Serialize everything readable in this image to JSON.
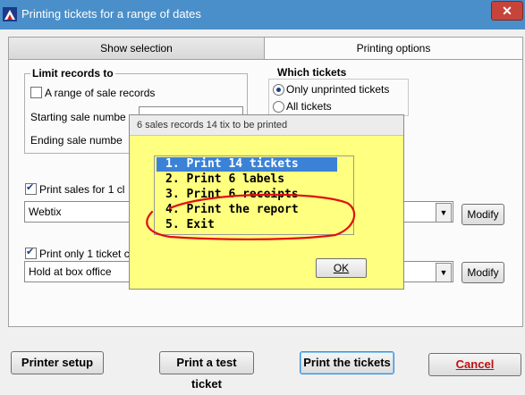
{
  "window": {
    "title": "Printing tickets for a range of dates",
    "close_glyph": "✕"
  },
  "tabs": [
    "Show selection",
    "Printing options"
  ],
  "limit": {
    "heading": "Limit records to",
    "range_check_label": "A range of sale records",
    "starting_label": "Starting sale numbe",
    "ending_label": "Ending sale numbe"
  },
  "which": {
    "heading": "Which tickets",
    "opt_unprinted": "Only unprinted tickets",
    "opt_all": "All tickets"
  },
  "print_sales": {
    "label": "Print sales for 1 cl",
    "combo_value": "Webtix",
    "modify_label": "Modify"
  },
  "print_only": {
    "label": "Print only 1 ticket c",
    "combo_value": "Hold at box office",
    "modify_label": "Modify"
  },
  "dialog": {
    "header": "6 sales records  14 tix to be printed",
    "items": [
      "1. Print 14 tickets",
      "2. Print 6 labels",
      "3. Print 6 receipts",
      "4. Print the report",
      "5. Exit"
    ],
    "ok_label": "OK",
    "annotation_color": "#e01010"
  },
  "bottom_buttons": {
    "printer_setup": "Printer setup",
    "test_ticket": "Print a test ticket",
    "print_tickets": "Print the tickets",
    "cancel": "Cancel"
  }
}
